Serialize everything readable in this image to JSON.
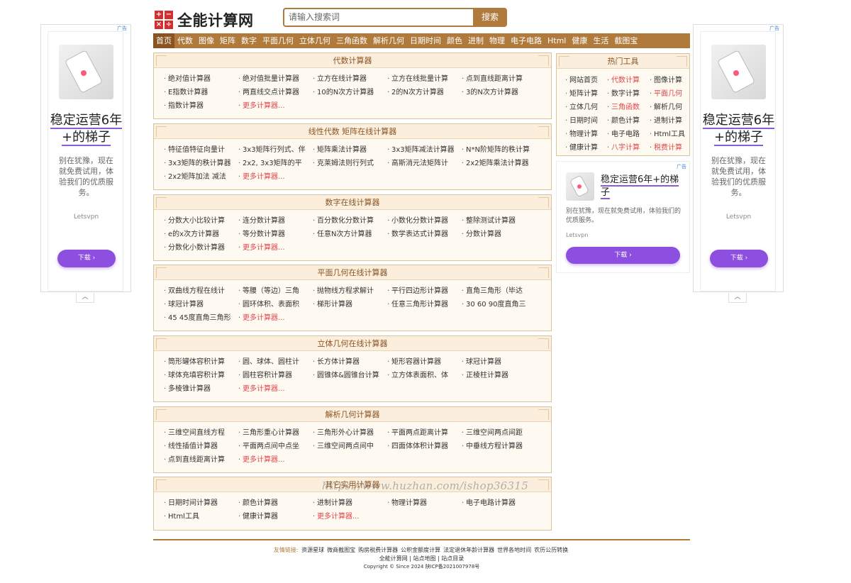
{
  "header": {
    "logo_cells": [
      "+",
      "−",
      "×",
      "÷"
    ],
    "site_name": "全能计算网",
    "search_placeholder": "请输入搜索词",
    "search_button": "搜索"
  },
  "nav": [
    "首页",
    "代数",
    "图像",
    "矩阵",
    "数字",
    "平面几何",
    "立体几何",
    "三角函数",
    "解析几何",
    "日期时间",
    "颜色",
    "进制",
    "物理",
    "电子电路",
    "Html",
    "健康",
    "生活",
    "截图宝"
  ],
  "panels": [
    {
      "title": "代数计算器",
      "links": [
        "绝对值计算器",
        "绝对值批量计算器",
        "立方在线计算器",
        "立方在线批量计算",
        "点到直线距离计算",
        "E指数计算器",
        "两直线交点计算器",
        "10的N次方计算器",
        "2的N次方计算器",
        "3的N次方计算器",
        "指数计算器"
      ],
      "more": "更多计算器..."
    },
    {
      "title": "线性代数 矩阵在线计算器",
      "links": [
        "特征值特征向量计",
        "3x3矩阵行列式、伴",
        "矩阵乘法计算器",
        "3x3矩阵减法计算器",
        "N*N阶矩阵的秩计算",
        "3x3矩阵的秩计算器",
        "2x2, 3x3矩阵的平",
        "克莱姆法则行列式",
        "高斯消元法矩阵计",
        "2x2矩阵乘法计算器",
        "2x2矩阵加法 减法"
      ],
      "more": "更多计算器..."
    },
    {
      "title": "数字在线计算器",
      "links": [
        "分数大小比较计算",
        "连分数计算器",
        "百分数化分数计算",
        "小数化分数计算器",
        "整除测试计算器",
        "e的x次方计算器",
        "等分数计算器",
        "任意N次方计算器",
        "数学表达式计算器",
        "分数计算器",
        "分数化小数计算器"
      ],
      "more": "更多计算器..."
    },
    {
      "title": "平面几何在线计算器",
      "links": [
        "双曲线方程在线计",
        "等腰（等边）三角",
        "抛物线方程求解计",
        "平行四边形计算器",
        "直角三角形（毕达",
        "球冠计算器",
        "圆环体积、表面积",
        "梯形计算器",
        "任意三角形计算器",
        "30 60 90度直角三",
        "45 45度直角三角形"
      ],
      "more": "更多计算器..."
    },
    {
      "title": "立体几何在线计算器",
      "links": [
        "筒形罐体容积计算",
        "圆、球体、圆柱计",
        "长方体计算器",
        "矩形容器计算器",
        "球冠计算器",
        "球体充填容积计算",
        "圆柱容积计算器",
        "圆锥体&圆锥台计算",
        "立方体表面积、体",
        "正棱柱计算器",
        "多棱锥计算器"
      ],
      "more": "更多计算器..."
    },
    {
      "title": "解析几何计算器",
      "links": [
        "三维空间直线方程",
        "三角形重心计算器",
        "三角形外心计算器",
        "平面两点距离计算",
        "三维空间两点间距",
        "线性插值计算器",
        "平面两点间中点坐",
        "三维空间两点间中",
        "四面体体积计算器",
        "中垂线方程计算器",
        "点到直线距离计算"
      ],
      "more": "更多计算器..."
    },
    {
      "title": "其它实用计算器",
      "links": [
        "日期时间计算器",
        "颜色计算器",
        "进制计算器",
        "物理计算器",
        "电子电路计算器",
        "Html工具",
        "健康计算器"
      ],
      "more": "更多计算器..."
    }
  ],
  "hot": {
    "title": "热门工具",
    "links": [
      {
        "label": "网站首页",
        "hl": false
      },
      {
        "label": "代数计算",
        "hl": true
      },
      {
        "label": "图像计算",
        "hl": false
      },
      {
        "label": "矩阵计算",
        "hl": false
      },
      {
        "label": "数字计算",
        "hl": false
      },
      {
        "label": "平面几何",
        "hl": true
      },
      {
        "label": "立体几何",
        "hl": false
      },
      {
        "label": "三角函数",
        "hl": true
      },
      {
        "label": "解析几何",
        "hl": false
      },
      {
        "label": "日期时间",
        "hl": false
      },
      {
        "label": "颜色计算",
        "hl": false
      },
      {
        "label": "进制计算",
        "hl": false
      },
      {
        "label": "物理计算",
        "hl": false
      },
      {
        "label": "电子电路",
        "hl": false
      },
      {
        "label": "Html工具",
        "hl": false
      },
      {
        "label": "健康计算",
        "hl": false
      },
      {
        "label": "八字计算",
        "hl": true
      },
      {
        "label": "税费计算",
        "hl": true
      }
    ]
  },
  "ads": {
    "tag": "广告",
    "side_title": "稳定运营6年+的梯子",
    "side_desc": "别在犹豫，现在就免费试用，体验我们的优质服务。",
    "mid_title": "稳定运营6年+的梯子",
    "mid_desc": "别在犹豫，现在就免费试用，体验我们的优质服务。",
    "brand": "Letsvpn",
    "button": "下载 ›"
  },
  "footer": {
    "links_label": "友情链接:",
    "links": [
      "资源星球",
      "微商截图宝",
      "购房税费计算器",
      "公积金额度计算",
      "法定退休年龄计算器",
      "世界各地时间",
      "农历公历转换"
    ],
    "sub_links": [
      "全能计算网",
      "站点地图",
      "站点目录"
    ],
    "copyright": "Copyright © Since 2024 陕ICP备2021007978号"
  },
  "watermark": "https://www.huzhan.com/ishop36315",
  "colors": {
    "accent": "#b07a3c",
    "highlight": "#e0464b",
    "panel_bg": "#fffaf1",
    "ad_button": "#8d4fe0"
  }
}
